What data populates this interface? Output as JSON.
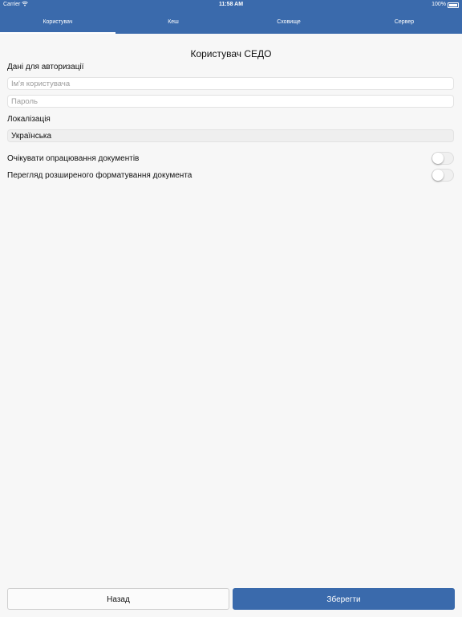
{
  "status_bar": {
    "carrier": "Carrier",
    "time": "11:58 AM",
    "battery": "100%"
  },
  "tabs": [
    {
      "label": "Користувач",
      "active": true
    },
    {
      "label": "Кеш",
      "active": false
    },
    {
      "label": "Сховище",
      "active": false
    },
    {
      "label": "Сервер",
      "active": false
    }
  ],
  "page_title": "Користувач СЕДО",
  "auth": {
    "label": "Дані для авторизації",
    "username_placeholder": "Ім'я користувача",
    "username_value": "",
    "password_placeholder": "Пароль",
    "password_value": ""
  },
  "localization": {
    "label": "Локалізація",
    "selected": "Українська"
  },
  "options": [
    {
      "label": "Очікувати опрацювання документів",
      "on": false
    },
    {
      "label": "Перегляд розширеного форматування документа",
      "on": false
    }
  ],
  "buttons": {
    "back": "Назад",
    "save": "Зберегти"
  },
  "colors": {
    "accent": "#3a6aac",
    "background": "#f7f7f7"
  }
}
